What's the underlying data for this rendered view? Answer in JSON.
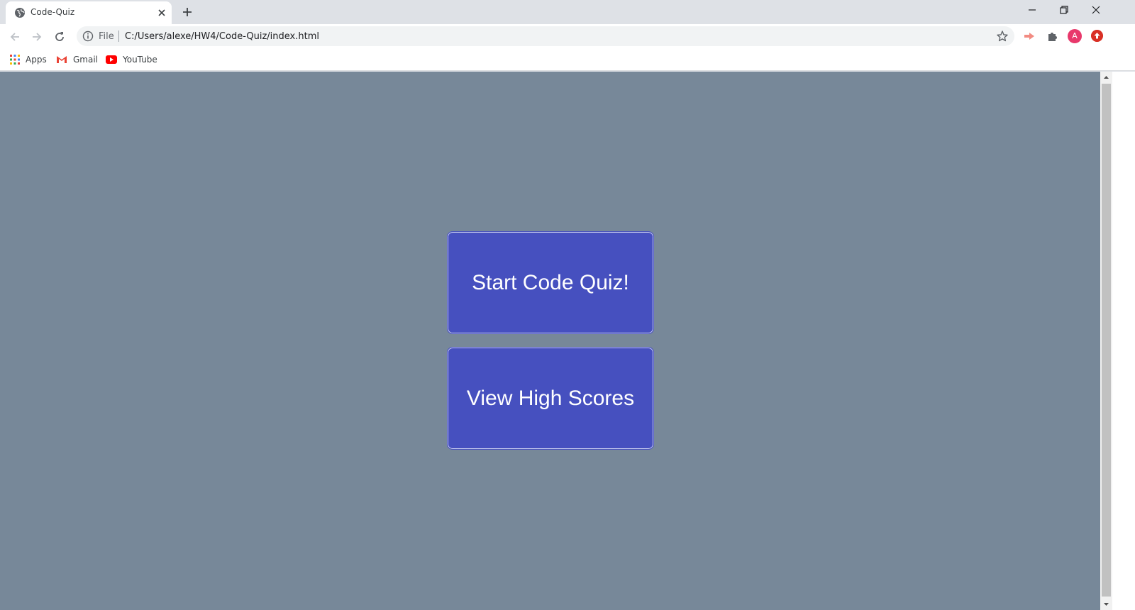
{
  "browser": {
    "tab": {
      "title": "Code-Quiz",
      "favicon": "globe-icon"
    },
    "toolbar": {
      "scheme_label": "File",
      "url": "C:/Users/alexe/HW4/Code-Quiz/index.html",
      "avatar_initial": "A"
    },
    "bookmarks": [
      {
        "label": "Apps",
        "icon": "apps-grid-icon"
      },
      {
        "label": "Gmail",
        "icon": "gmail-icon"
      },
      {
        "label": "YouTube",
        "icon": "youtube-icon"
      }
    ]
  },
  "page": {
    "background_color": "#778899",
    "button_color": "#4650bf",
    "start_button_label": "Start Code Quiz!",
    "scores_button_label": "View High Scores"
  }
}
